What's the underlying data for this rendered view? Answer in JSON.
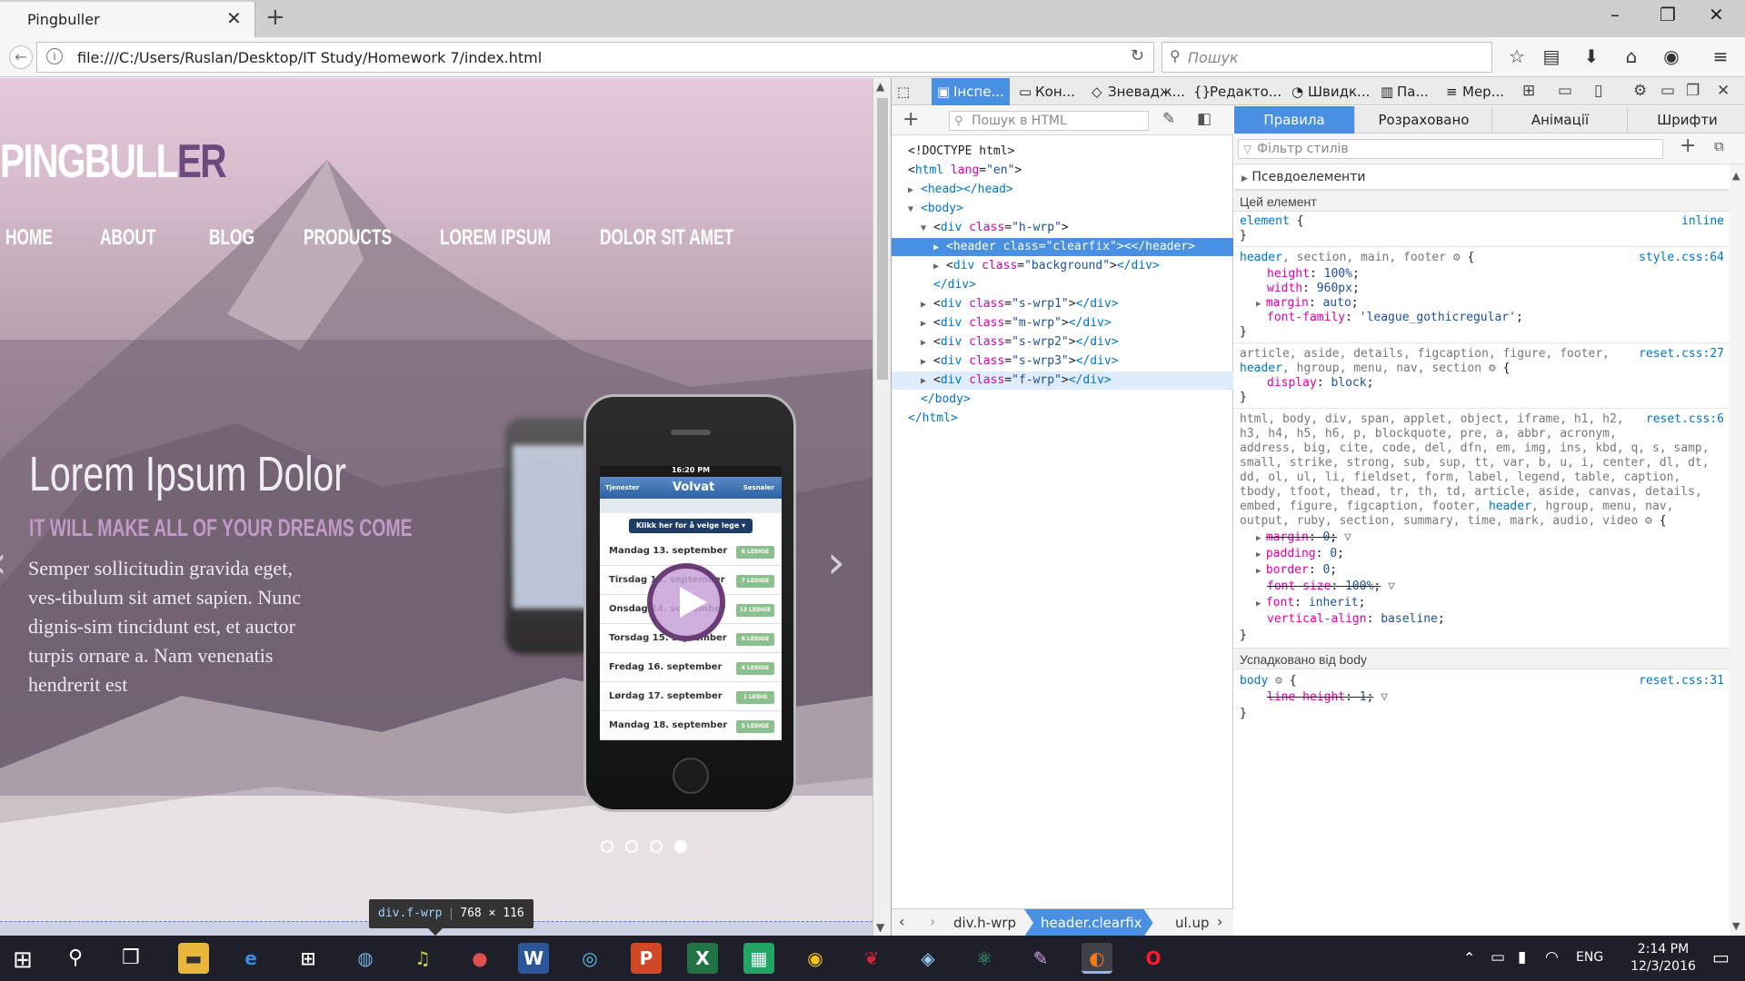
{
  "browser": {
    "tab_title": "Pingbuller",
    "url": "file:///C:/Users/Ruslan/Desktop/IT Study/Homework 7/index.html",
    "search_placeholder": "Пошук"
  },
  "page": {
    "logo_main": "PINGBULL",
    "logo_accent": "ER",
    "menu": [
      "HOME",
      "ABOUT",
      "BLOG",
      "PRODUCTS",
      "LOREM IPSUM",
      "DOLOR SIT AMET"
    ],
    "slide_title": "Lorem Ipsum Dolor",
    "slide_subtitle": "IT WILL MAKE ALL OF YOUR DREAMS COME",
    "slide_text": "Semper sollicitudin gravida eget, ves-tibulum sit amet sapien. Nunc dignis-sim tincidunt est, et auctor turpis ornare a. Nam venenatis hendrerit est",
    "phone": {
      "time": "16:20 PM",
      "brand": "Volvat",
      "back_label": "Tjenester",
      "right_label": "Sesnaler",
      "button": "Klikk her for å velge lege ▾",
      "rows": [
        {
          "day": "Mandag 13. september",
          "badge": "6 LEDIGE"
        },
        {
          "day": "Tirsdag 14. september",
          "badge": "7 LEDIGE"
        },
        {
          "day": "Onsdag 14. september",
          "badge": "13 LEDIGE"
        },
        {
          "day": "Torsdag 15. september",
          "badge": "6 LEDIGE"
        },
        {
          "day": "Fredag 16. september",
          "badge": "4 LEDIGE"
        },
        {
          "day": "Lørdag 17. september",
          "badge": "1 LEDIG"
        },
        {
          "day": "Mandag 18. september",
          "badge": "5 LEDIGE"
        }
      ]
    },
    "highlight_tag": "div.f-wrp",
    "highlight_size": "768 × 116"
  },
  "devtools": {
    "tabs": [
      "Інспе...",
      "Кон...",
      "Зневадж...",
      "Редакто...",
      "Швидк...",
      "Па...",
      "Мер..."
    ],
    "html_search_placeholder": "Пошук в HTML",
    "tree": {
      "doctype": "<!DOCTYPE html>",
      "html_open": "html",
      "html_attr": "lang",
      "html_val": "\"en\"",
      "head": "<head></head>",
      "body": "<body>",
      "div_tag": "div",
      "class_attr": "class",
      "hwrp": "\"h-wrp\"",
      "header_tag": "header",
      "clearfix": "\"clearfix\"",
      "header_close": "</header>",
      "background": "\"background\"",
      "div_close": "</div>",
      "div_only_close": "</div>",
      "swrp1": "\"s-wrp1\"",
      "mwrp": "\"m-wrp\"",
      "swrp2": "\"s-wrp2\"",
      "swrp3": "\"s-wrp3\"",
      "fwrp": "\"f-wrp\"",
      "body_close": "</body>",
      "html_close": "</html>"
    },
    "breadcrumbs": [
      "div.h-wrp",
      "header.clearfix",
      "ul.up"
    ],
    "rules_tabs": [
      "Правила",
      "Розраховано",
      "Анімації",
      "Шрифти"
    ],
    "filter_placeholder": "Фільтр стилів",
    "pseudo": "Псевдоелементи",
    "this_element": "Цей елемент",
    "inherited": "Успадковано від body",
    "rules": {
      "element_sel": "element",
      "element_src": "inline",
      "r1_sel_a": "header",
      "r1_sel_b": ", section, main, footer",
      "r1_src": "style.css:64",
      "r1_p1": "height",
      "r1_v1": "100%",
      "r1_p2": "width",
      "r1_v2": "960px",
      "r1_p3": "margin",
      "r1_v3": "auto",
      "r1_p4": "font-family",
      "r1_v4": "'league_gothicregular'",
      "r2_sel_a": "article, aside, details, figcaption, figure, footer,",
      "r2_sel_b": "header",
      "r2_sel_c": ", hgroup, menu, nav, section",
      "r2_src": "reset.css:27",
      "r2_p1": "display",
      "r2_v1": "block",
      "r3_lines": [
        "html, body, div, span, applet, object, iframe, h1, h2,",
        "h3, h4, h5, h6, p, blockquote, pre, a, abbr, acronym,",
        "address, big, cite, code, del, dfn, em, img, ins, kbd, q, s, samp,",
        "small, strike, strong, sub, sup, tt, var, b, u, i, center, dl, dt,",
        "dd, ol, ul, li, fieldset, form, label, legend, table, caption,",
        "tbody, tfoot, thead, tr, th, td, article, aside, canvas, details,",
        "embed, figure, figcaption, footer,"
      ],
      "r3_line7_match": "header",
      "r3_line7_rest": ", hgroup, menu, nav,",
      "r3_line8": "output, ruby, section, summary, time, mark, audio, video",
      "r3_src": "reset.css:6",
      "r3_p1": "margin",
      "r3_v1": "0",
      "r3_p2": "padding",
      "r3_v2": "0",
      "r3_p3": "border",
      "r3_v3": "0",
      "r3_p4": "font-size",
      "r3_v4": "100%",
      "r3_p5": "font",
      "r3_v5": "inherit",
      "r3_p6": "vertical-align",
      "r3_v6": "baseline",
      "r4_sel": "body",
      "r4_src": "reset.css:31",
      "r4_p1": "line-height",
      "r4_v1": "1"
    }
  },
  "taskbar": {
    "lang": "ENG",
    "time": "2:14 PM",
    "date": "12/3/2016"
  }
}
